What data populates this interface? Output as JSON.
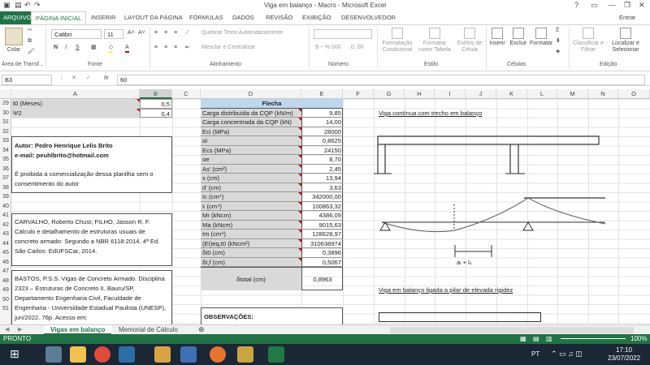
{
  "window": {
    "title": "Viga em balanço - Macro - Microsoft Excel",
    "help": "?",
    "signin": "Entrar"
  },
  "ribbon_tabs": [
    "ARQUIVO",
    "PÁGINA INICIAL",
    "INSERIR",
    "LAYOUT DA PÁGINA",
    "FÓRMULAS",
    "DADOS",
    "REVISÃO",
    "EXIBIÇÃO",
    "DESENVOLVEDOR"
  ],
  "ribbon": {
    "paste": "Colar",
    "clipboard": "Área de Transf...",
    "font_name": "Calibri",
    "font_size": "11",
    "font_group": "Fonte",
    "wrap": "Quebrar Texto Automaticamente",
    "merge": "Mesclar e Centralizar",
    "align_group": "Alinhamento",
    "number_group": "Número",
    "number_fmt1": "$ ~ % 000",
    "number_fmt2": ",0 ,00",
    "cond": "Formatação Condicional",
    "fmt_table": "Formatar como Tabela",
    "cell_styles": "Estilos de Célula",
    "styles_group": "Estilo",
    "insert": "Inserir",
    "delete": "Excluir",
    "format": "Formatar",
    "cells_group": "Células",
    "sort": "Classificar e Filtrar",
    "find": "Localizar e Selecionar",
    "edit_group": "Edição"
  },
  "formula_bar": {
    "name_box": "B3",
    "fx": "fx",
    "value": "60"
  },
  "columns": [
    "A",
    "B",
    "C",
    "D",
    "E",
    "F",
    "G",
    "H",
    "I",
    "J",
    "K",
    "L",
    "M",
    "N",
    "O"
  ],
  "selected_column": "B",
  "rows": [
    "29",
    "30",
    "31",
    "32",
    "33",
    "34",
    "35",
    "36",
    "37",
    "38",
    "39",
    "40",
    "41",
    "42",
    "43",
    "44",
    "45",
    "46",
    "47",
    "48",
    "49",
    "50",
    "51"
  ],
  "cells": {
    "a29": "t0 (Meses)",
    "b29": "0,5",
    "a30": "Ψ2",
    "b30": "0,4",
    "author1": "Autor: Pedro Henrique Lelis Brito",
    "author2": "e-mail: peuhlbrito@hotmail.com",
    "author3": "É proibida a comercialização dessa planilha sem o",
    "author4": "consentimento do autor",
    "ref1": [
      "CARVALHO, Roberto Chust; FILHO, Jasson R. F.",
      "Cálculo e detalhamento de estruturas usuais de",
      "concreto armado: Segundo a NBR 6118:2014. 4ª Ed.",
      "São Carlos: EdUFSCar, 2014."
    ],
    "ref2": [
      "BASTOS, P.S.S. Vigas de Concreto Armado. Disciplina",
      "2323 – Estruturas de Concreto II. Bauru/SP,",
      "Departamento Engenharia Civil, Faculdade de",
      "Engenharia - Universidade Estadual Paulista (UNESP),",
      "jun/2022. 76p. Acesso em:"
    ]
  },
  "flecha": {
    "header": "Flecha",
    "rows": [
      [
        "Carga distribuída da CQP (kN/m)",
        "9,85"
      ],
      [
        "Carga concentrada da CQP (kN)",
        "14,00"
      ],
      [
        "Eci (MPa)",
        "28000"
      ],
      [
        "αi",
        "0,8625"
      ],
      [
        "Ecs (MPa)",
        "24150"
      ],
      [
        "αe",
        "8,70"
      ],
      [
        "As' (cm²)",
        "2,45"
      ],
      [
        "x (cm)",
        "13,94"
      ],
      [
        "d' (cm)",
        "3,63"
      ],
      [
        "Ic (cm⁴)",
        "342000,00"
      ],
      [
        "Iₗ (cm⁴)",
        "100863,32"
      ],
      [
        "Mr (kNcm)",
        "4386,09"
      ],
      [
        "Ma (kNcm)",
        "9015,63"
      ],
      [
        "Im (cm⁴)",
        "128628,97"
      ],
      [
        "(EI)eq,t0 (kNcm²)",
        "310638974"
      ],
      [
        "δt0 (cm)",
        "0,3896"
      ],
      [
        "δt,f (cm)",
        "0,5067"
      ]
    ],
    "total_label": "δtotal (cm)",
    "total_value": "0,8963",
    "obs": "OBSERVAÇÕES:"
  },
  "diagrams": {
    "title1": "Viga contínua com trecho em balanço",
    "span": "aₗ + lₛ",
    "title2": "Viga em balanço ligada a pilar de elevada rigidez"
  },
  "sheets": [
    "Vigas em balanço",
    "Memorial de Cálculo"
  ],
  "status": {
    "left": "PRONTO",
    "zoom": "100%"
  },
  "taskbar": {
    "lang": "PT",
    "time": "17:10",
    "date": "23/07/2022"
  }
}
